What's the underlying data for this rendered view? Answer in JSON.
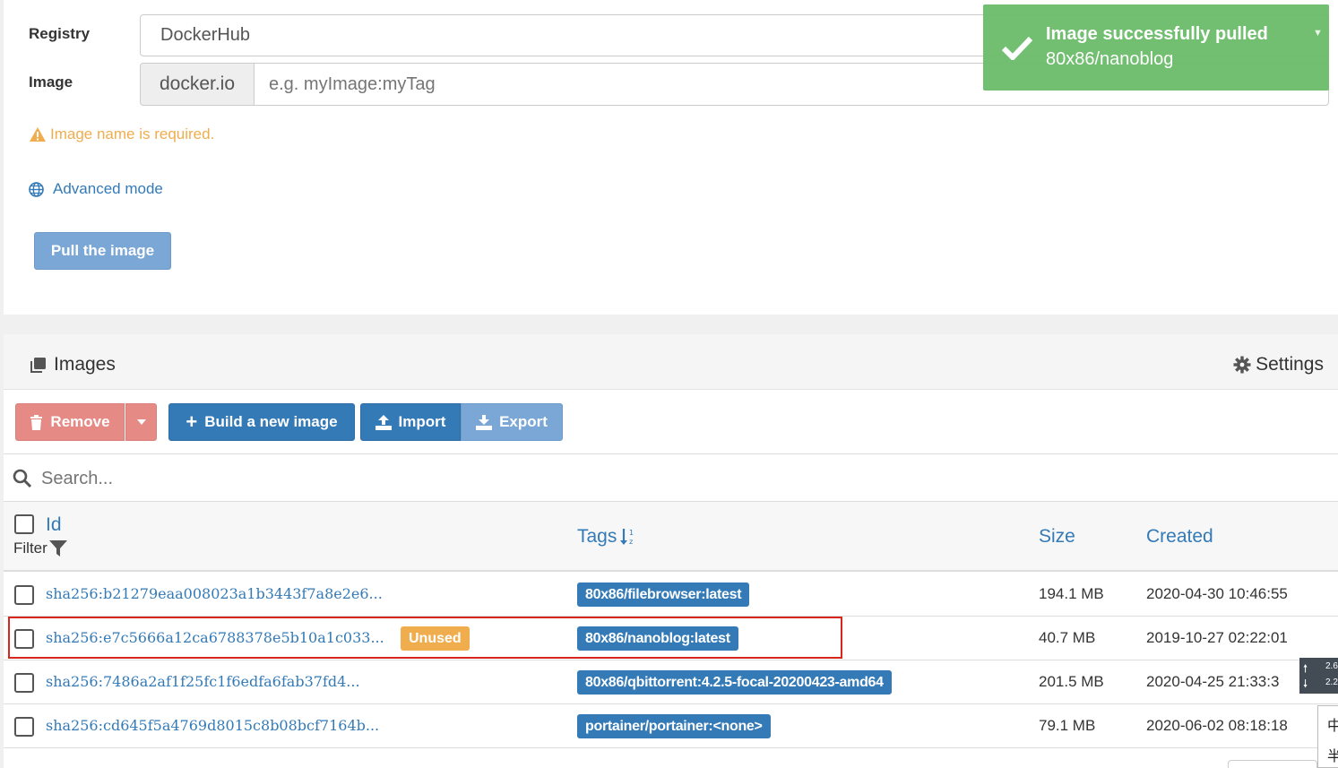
{
  "pull_form": {
    "registry_label": "Registry",
    "registry_value": "DockerHub",
    "image_label": "Image",
    "image_prefix": "docker.io",
    "image_placeholder": "e.g. myImage:myTag",
    "image_value": "",
    "warning": "Image name is required.",
    "advanced_mode": "Advanced mode",
    "pull_button": "Pull the image"
  },
  "toast": {
    "title": "Image successfully pulled",
    "message": "80x86/nanoblog"
  },
  "images": {
    "title": "Images",
    "settings": "Settings",
    "toolbar": {
      "remove": "Remove",
      "build": "Build a new image",
      "import": "Import",
      "export": "Export"
    },
    "search_placeholder": "Search...",
    "columns": {
      "id": "Id",
      "filter": "Filter",
      "tags": "Tags",
      "size": "Size",
      "created": "Created"
    },
    "rows": [
      {
        "id": "sha256:b21279eaa008023a1b3443f7a8e2e6...",
        "badge": "",
        "tag": "80x86/filebrowser:latest",
        "size": "194.1 MB",
        "created": "2020-04-30 10:46:55"
      },
      {
        "id": "sha256:e7c5666a12ca6788378e5b10a1c033...",
        "badge": "Unused",
        "tag": "80x86/nanoblog:latest",
        "size": "40.7 MB",
        "created": "2019-10-27 02:22:01"
      },
      {
        "id": "sha256:7486a2af1f25fc1f6edfa6fab37fd4...",
        "badge": "",
        "tag": "80x86/qbittorrent:4.2.5-focal-20200423-amd64",
        "size": "201.5 MB",
        "created": "2020-04-25 21:33:3"
      },
      {
        "id": "sha256:cd645f5a4769d8015c8b08bcf7164b...",
        "badge": "",
        "tag": "portainer/portainer:<none>",
        "size": "79.1 MB",
        "created": "2020-06-02 08:18:18"
      }
    ]
  },
  "side_widget": {
    "line1": "2.6",
    "line2": "2.2",
    "char1": "中",
    "char2": "半"
  },
  "colors": {
    "primary": "#337ab7",
    "danger": "#e68a86",
    "warning": "#f0ad4e",
    "success": "#6ebd6e",
    "highlight": "#d9261c"
  }
}
